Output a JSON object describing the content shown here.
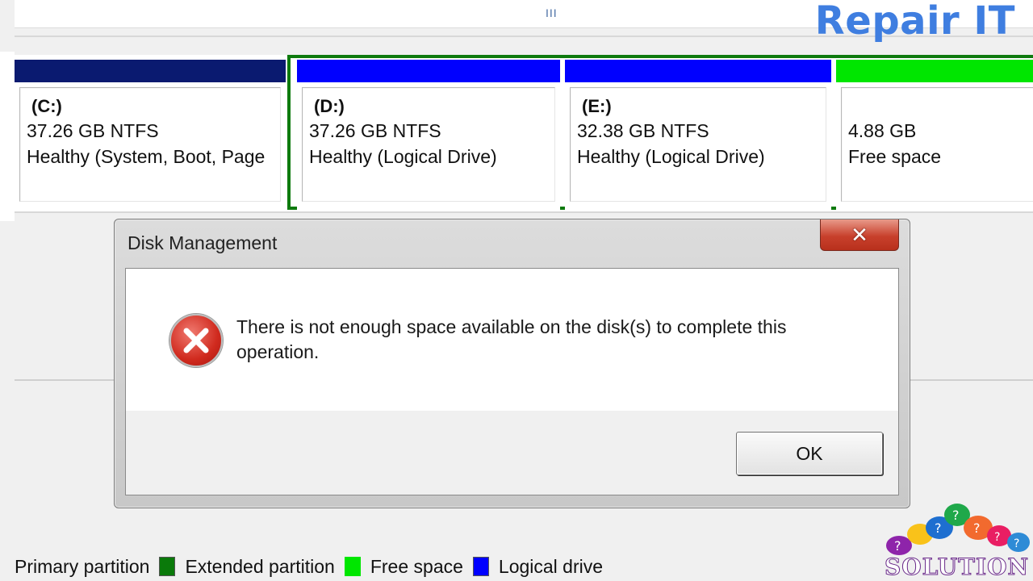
{
  "watermark": "Repair IT",
  "scrollbar_grip": "III",
  "partitions": [
    {
      "name": "(C:)",
      "size": "37.26 GB NTFS",
      "status": "Healthy (System, Boot, Page",
      "bar_color": "#0a1a70"
    },
    {
      "name": "(D:)",
      "size": "37.26 GB NTFS",
      "status": "Healthy (Logical Drive)",
      "bar_color": "#0000ff"
    },
    {
      "name": "(E:)",
      "size": "32.38 GB NTFS",
      "status": "Healthy (Logical Drive)",
      "bar_color": "#0000ff"
    },
    {
      "name": "",
      "size": "4.88 GB",
      "status": "Free space",
      "bar_color": "#00e600"
    }
  ],
  "dialog": {
    "title": "Disk Management",
    "close_symbol": "✕",
    "message": "There is not enough space available on the disk(s) to complete this operation.",
    "ok_label": "OK",
    "icon": "error-icon"
  },
  "legend": [
    {
      "label": "Primary partition",
      "color": "#0a7a0a"
    },
    {
      "label": "Extended partition",
      "color": "#00e600"
    },
    {
      "label": "Free space",
      "color": "#0000ff"
    },
    {
      "label": "Logical drive",
      "color": ""
    }
  ],
  "logo": {
    "text": "SOLUTION",
    "icon": "speech-bubbles-icon"
  },
  "colors": {
    "extended_border": "#0e7a0e",
    "accent": "#3f7ee0",
    "error_red": "#d02a1e"
  }
}
